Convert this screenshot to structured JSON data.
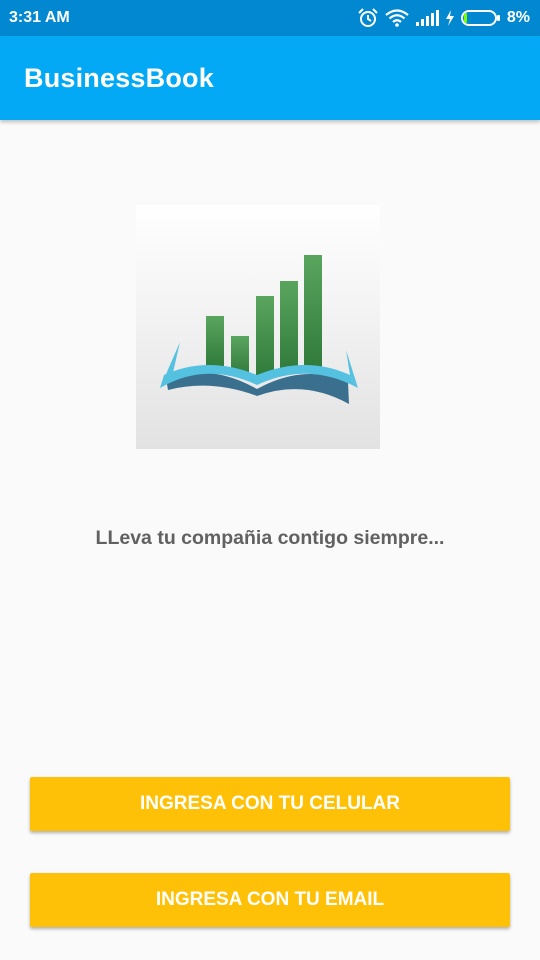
{
  "status_bar": {
    "time": "3:31 AM",
    "battery_percent": "8%",
    "icons": [
      "alarm-icon",
      "wifi-icon",
      "signal-icon",
      "charging-icon",
      "battery-icon"
    ],
    "battery_level": 0.08
  },
  "app_bar": {
    "title": "BusinessBook",
    "color": "#03a9f4"
  },
  "logo": {
    "icon": "book-chart-logo"
  },
  "main": {
    "tagline": "LLeva tu compañia contigo siempre..."
  },
  "buttons": {
    "phone_label": "INGRESA CON TU CELULAR",
    "email_label": "INGRESA CON TU EMAIL",
    "color": "#ffc107"
  }
}
